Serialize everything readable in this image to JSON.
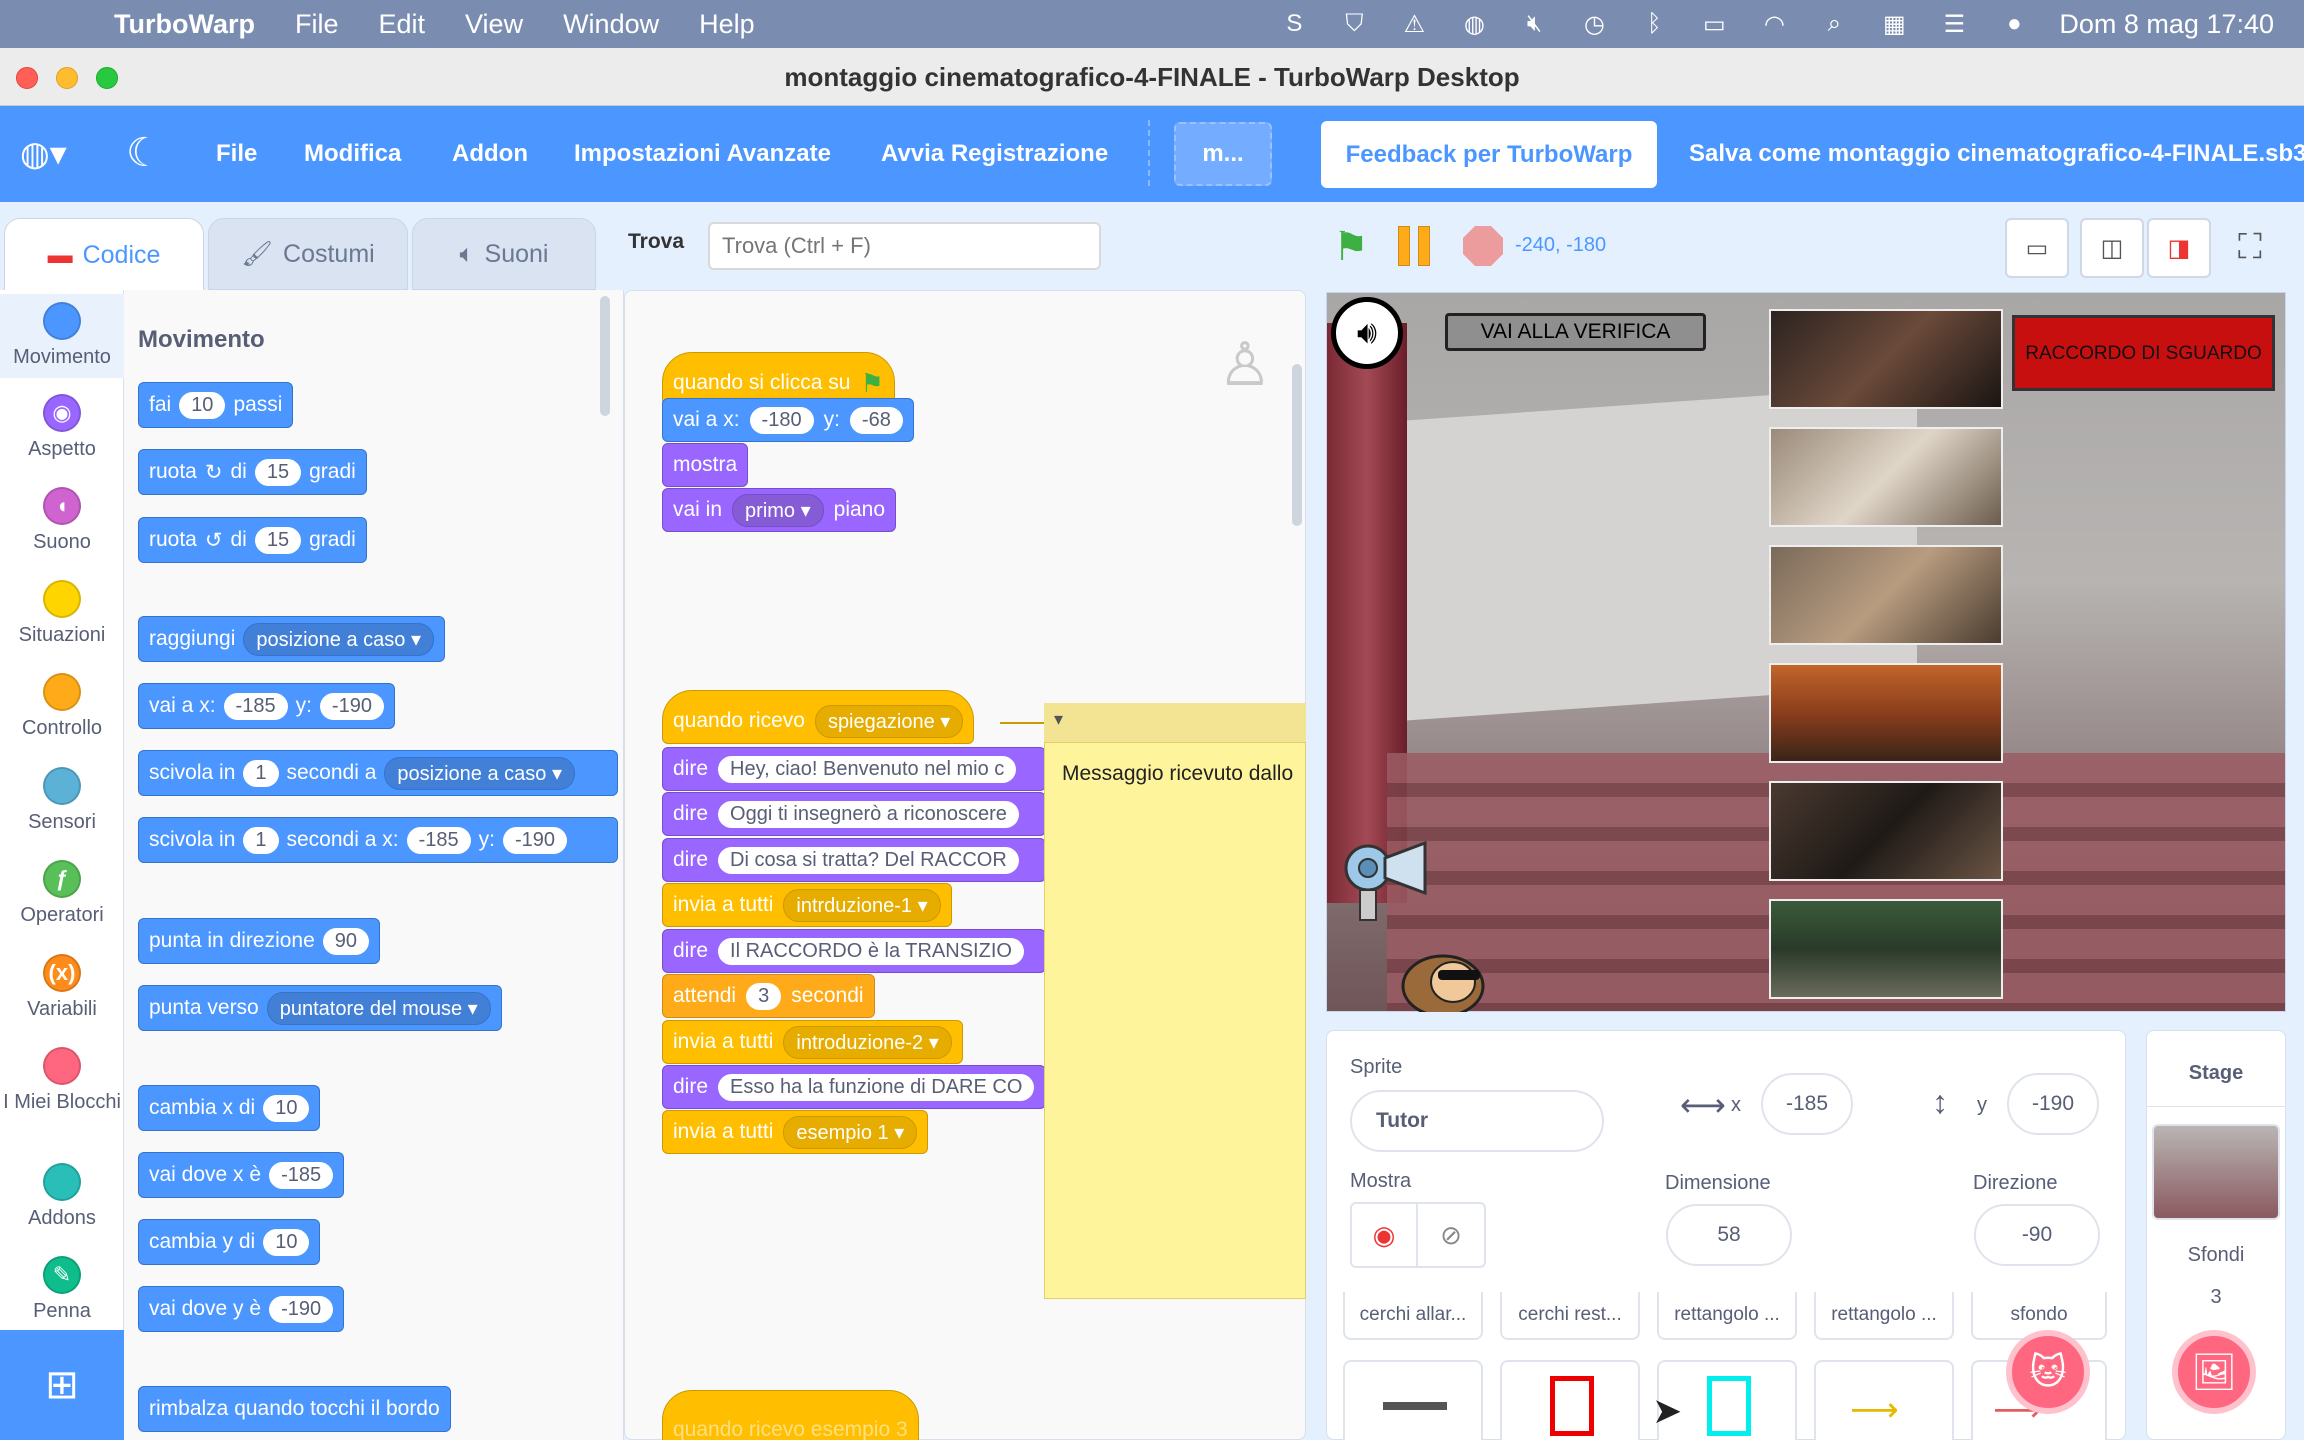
{
  "macos": {
    "app_name": "TurboWarp",
    "menu": [
      "File",
      "Edit",
      "View",
      "Window",
      "Help"
    ],
    "clock": "Dom 8 mag  17:40"
  },
  "window": {
    "title": "montaggio cinematografico-4-FINALE - TurboWarp Desktop"
  },
  "tw_menu": {
    "file": "File",
    "edit": "Modifica",
    "addon": "Addon",
    "advanced": "Impostazioni Avanzate",
    "record": "Avvia Registrazione",
    "more": "m...",
    "feedback": "Feedback per TurboWarp",
    "save_as": "Salva come montaggio cinematografico-4-FINALE.sb3"
  },
  "tabs": {
    "code": "Codice",
    "costumes": "Costumi",
    "sounds": "Suoni"
  },
  "find": {
    "label": "Trova",
    "placeholder": "Trova (Ctrl + F)"
  },
  "categories": [
    {
      "label": "Movimento",
      "color": "#4c97ff"
    },
    {
      "label": "Aspetto",
      "color": "#9966ff"
    },
    {
      "label": "Suono",
      "color": "#cf63cf"
    },
    {
      "label": "Situazioni",
      "color": "#ffd500"
    },
    {
      "label": "Controllo",
      "color": "#ffab19"
    },
    {
      "label": "Sensori",
      "color": "#5cb1d6"
    },
    {
      "label": "Operatori",
      "color": "#59c059"
    },
    {
      "label": "Variabili",
      "color": "#ff8c1a"
    },
    {
      "label": "I Miei Blocchi",
      "color": "#ff6680"
    },
    {
      "label": "Addons",
      "color": "#29beb8"
    },
    {
      "label": "Penna",
      "color": "#0fbd8c"
    }
  ],
  "palette": {
    "title": "Movimento",
    "b1": {
      "a": "fai",
      "v": "10",
      "b": "passi"
    },
    "b2": {
      "a": "ruota",
      "sym": "↻",
      "b": "di",
      "v": "15",
      "c": "gradi"
    },
    "b3": {
      "a": "ruota",
      "sym": "↺",
      "b": "di",
      "v": "15",
      "c": "gradi"
    },
    "b4": {
      "a": "raggiungi",
      "d": "posizione a caso"
    },
    "b5": {
      "a": "vai a x:",
      "x": "-185",
      "b": "y:",
      "y": "-190"
    },
    "b6": {
      "a": "scivola in",
      "v": "1",
      "b": "secondi a",
      "d": "posizione a caso"
    },
    "b7": {
      "a": "scivola in",
      "v": "1",
      "b": "secondi a x:",
      "x": "-185",
      "c": "y:",
      "y": "-190"
    },
    "b8": {
      "a": "punta in direzione",
      "v": "90"
    },
    "b9": {
      "a": "punta verso",
      "d": "puntatore del mouse"
    },
    "b10": {
      "a": "cambia x di",
      "v": "10"
    },
    "b11": {
      "a": "vai dove x è",
      "v": "-185"
    },
    "b12": {
      "a": "cambia y di",
      "v": "10"
    },
    "b13": {
      "a": "vai dove y è",
      "v": "-190"
    },
    "b14": {
      "a": "rimbalza quando tocchi il bordo"
    }
  },
  "script1": {
    "hat": "quando si clicca su",
    "goto": {
      "a": "vai a x:",
      "x": "-180",
      "b": "y:",
      "y": "-68"
    },
    "show": "mostra",
    "layer": {
      "a": "vai in",
      "d": "primo",
      "b": "piano"
    }
  },
  "script2": {
    "hat": {
      "a": "quando ricevo",
      "d": "spiegazione"
    },
    "say1": {
      "a": "dire",
      "t": "Hey, ciao! Benvenuto nel mio c"
    },
    "say2": {
      "a": "dire",
      "t": "Oggi ti insegnerò a riconoscere"
    },
    "say3": {
      "a": "dire",
      "t": "Di cosa si tratta? Del RACCOR"
    },
    "bc1": {
      "a": "invia a tutti",
      "d": "intrduzione-1"
    },
    "say4": {
      "a": "dire",
      "t": "Il RACCORDO è la TRANSIZIO"
    },
    "wait": {
      "a": "attendi",
      "v": "3",
      "b": "secondi"
    },
    "bc2": {
      "a": "invia a tutti",
      "d": "introduzione-2"
    },
    "say5": {
      "a": "dire",
      "t": "Esso ha la funzione di DARE CO"
    },
    "bc3": {
      "a": "invia a tutti",
      "d": "esempio 1"
    }
  },
  "script3": {
    "hat": "quando ricevo esempio 3"
  },
  "comment": "Messaggio ricevuto dallo",
  "stage": {
    "coords": "-240, -180",
    "btn_verifica": "VAI ALLA VERIFICA",
    "btn_raccordo": "RACCORDO DI SGUARDO"
  },
  "sprite_info": {
    "sprite_label": "Sprite",
    "sprite_name": "Tutor",
    "x_label": "x",
    "x": "-185",
    "y_label": "y",
    "y": "-190",
    "show_label": "Mostra",
    "size_label": "Dimensione",
    "size": "58",
    "dir_label": "Direzione",
    "dir": "-90",
    "costumes": [
      "cerchi allar...",
      "cerchi rest...",
      "rettangolo ...",
      "rettangolo ...",
      "sfondo"
    ]
  },
  "stage_pane": {
    "title": "Stage",
    "backdrops_label": "Sfondi",
    "backdrops_count": "3"
  }
}
